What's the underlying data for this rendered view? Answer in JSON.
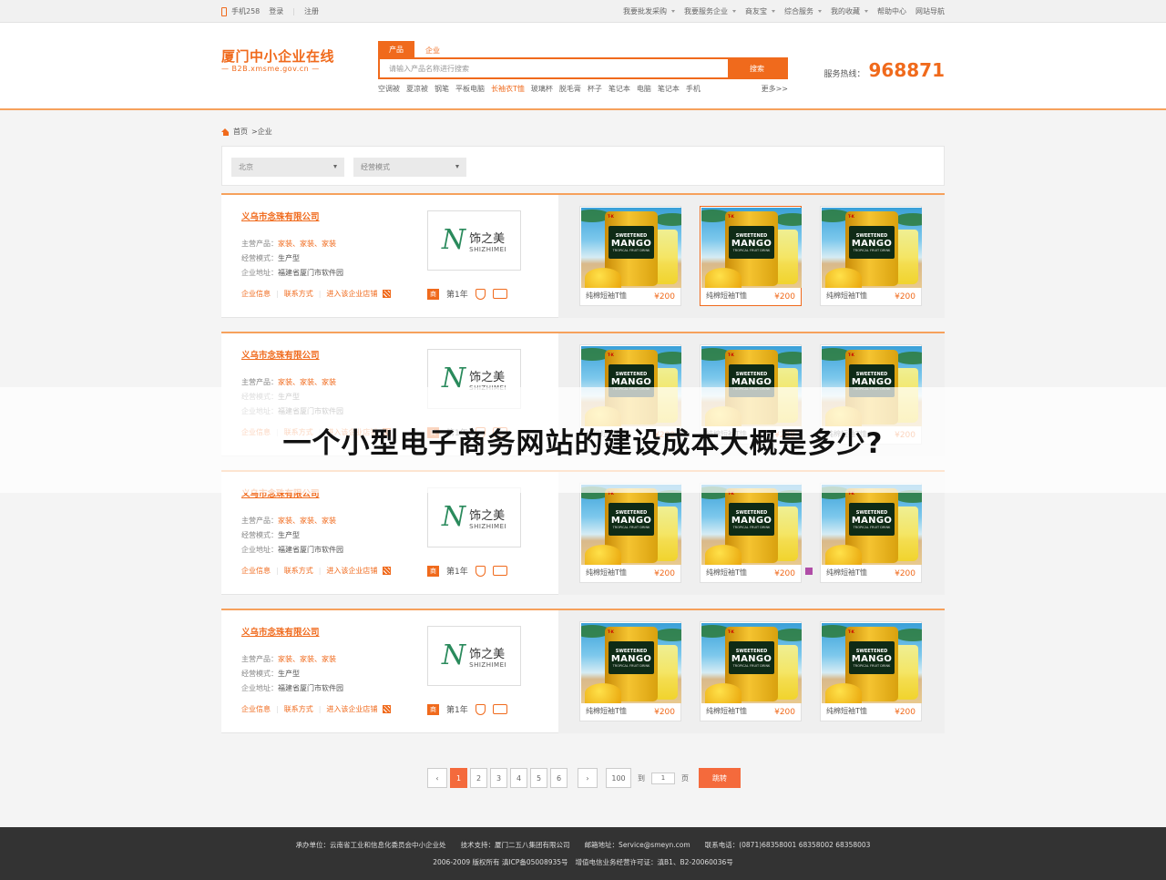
{
  "topbar": {
    "mobile": "手机258",
    "login": "登录",
    "register": "注册",
    "menu": [
      {
        "label": "我要批发采购",
        "caret": true
      },
      {
        "label": "我要服务企业",
        "caret": true
      },
      {
        "label": "商友宝",
        "caret": true
      },
      {
        "label": "综合服务",
        "caret": true
      },
      {
        "label": "我的收藏",
        "caret": true
      },
      {
        "label": "帮助中心",
        "caret": false
      },
      {
        "label": "网站导航",
        "caret": false
      }
    ]
  },
  "header": {
    "site_name": "厦门中小企业在线",
    "site_domain": "—  B2B.xmsme.gov.cn  —",
    "search_tabs": [
      "产品",
      "企业"
    ],
    "search_placeholder": "请输入产品名称进行搜索",
    "search_button": "搜索",
    "hot_words": [
      "空调被",
      "夏凉被",
      "钢笔",
      "平板电脑",
      "长袖衣T恤",
      "玻璃杯",
      "脱毛膏",
      "杯子",
      "笔记本",
      "电脑",
      "笔记本",
      "手机"
    ],
    "hot_highlight_index": 4,
    "more": "更多>>",
    "hotline_label": "服务热线：",
    "hotline_number": "968871"
  },
  "breadcrumb": {
    "home": "首页",
    "current": ">企业"
  },
  "filters": [
    {
      "label": "北京"
    },
    {
      "label": "经营模式"
    }
  ],
  "company_labels": {
    "main_products": "主营产品：",
    "business_mode": "经营模式：",
    "address": "企业地址：",
    "info": "企业信息",
    "contact": "联系方式",
    "enter_store": "进入该企业店铺",
    "year": "第1年"
  },
  "companies": [
    {
      "name": "义乌市念珠有限公司",
      "products": "家装、家装、家装",
      "mode": "生产型",
      "address": "福建省厦门市软件园",
      "logo_cn": "饰之美",
      "logo_en": "SHIZHIMEI",
      "items": [
        {
          "name": "纯棉短袖T恤",
          "price": "¥200"
        },
        {
          "name": "纯棉短袖T恤",
          "price": "¥200"
        },
        {
          "name": "纯棉短袖T恤",
          "price": "¥200"
        }
      ],
      "selected": 1
    },
    {
      "name": "义乌市念珠有限公司",
      "products": "家装、家装、家装",
      "mode": "生产型",
      "address": "福建省厦门市软件园",
      "logo_cn": "饰之美",
      "logo_en": "SHIZHIMEI",
      "items": [
        {
          "name": "纯棉短袖T恤",
          "price": "¥200"
        },
        {
          "name": "纯棉短袖T恤",
          "price": "¥200"
        },
        {
          "name": "纯棉短袖T恤",
          "price": "¥200"
        }
      ],
      "selected": -1
    },
    {
      "name": "义乌市念珠有限公司",
      "products": "家装、家装、家装",
      "mode": "生产型",
      "address": "福建省厦门市软件园",
      "logo_cn": "饰之美",
      "logo_en": "SHIZHIMEI",
      "items": [
        {
          "name": "纯棉短袖T恤",
          "price": "¥200"
        },
        {
          "name": "纯棉短袖T恤",
          "price": "¥200"
        },
        {
          "name": "纯棉短袖T恤",
          "price": "¥200"
        }
      ],
      "selected": -1
    },
    {
      "name": "义乌市念珠有限公司",
      "products": "家装、家装、家装",
      "mode": "生产型",
      "address": "福建省厦门市软件园",
      "logo_cn": "饰之美",
      "logo_en": "SHIZHIMEI",
      "items": [
        {
          "name": "纯棉短袖T恤",
          "price": "¥200"
        },
        {
          "name": "纯棉短袖T恤",
          "price": "¥200"
        },
        {
          "name": "纯棉短袖T恤",
          "price": "¥200"
        }
      ],
      "selected": -1
    }
  ],
  "product_can": {
    "brand": "T-K",
    "line1": "SWEETENED",
    "line2": "MANGO",
    "line3": "TROPICAL FRUIT DRINK"
  },
  "overlay_title": "一个小型电子商务网站的建设成本大概是多少?",
  "pagination": {
    "prev": "‹",
    "pages": [
      "1",
      "2",
      "3",
      "4",
      "5",
      "6"
    ],
    "current": "1",
    "next": "›",
    "last": "100",
    "to_label": "到",
    "page_input": "1",
    "page_label": "页",
    "jump": "跳转"
  },
  "footer": {
    "line1": [
      "承办单位：云南省工业和信息化委员会中小企业处",
      "技术支持：厦门二五八集团有限公司",
      "邮箱地址：Service@smeyn.com",
      "联系电话：(0871)68358001 68358002 68358003"
    ],
    "line2": [
      "2006-2009 版权所有 滇ICP备05008935号",
      "增值电信业务经营许可证：滇B1、B2-20060036号"
    ]
  },
  "colors": {
    "accent": "#f06a1c",
    "footer_bg": "#333333",
    "overlay": "#ffffff"
  }
}
